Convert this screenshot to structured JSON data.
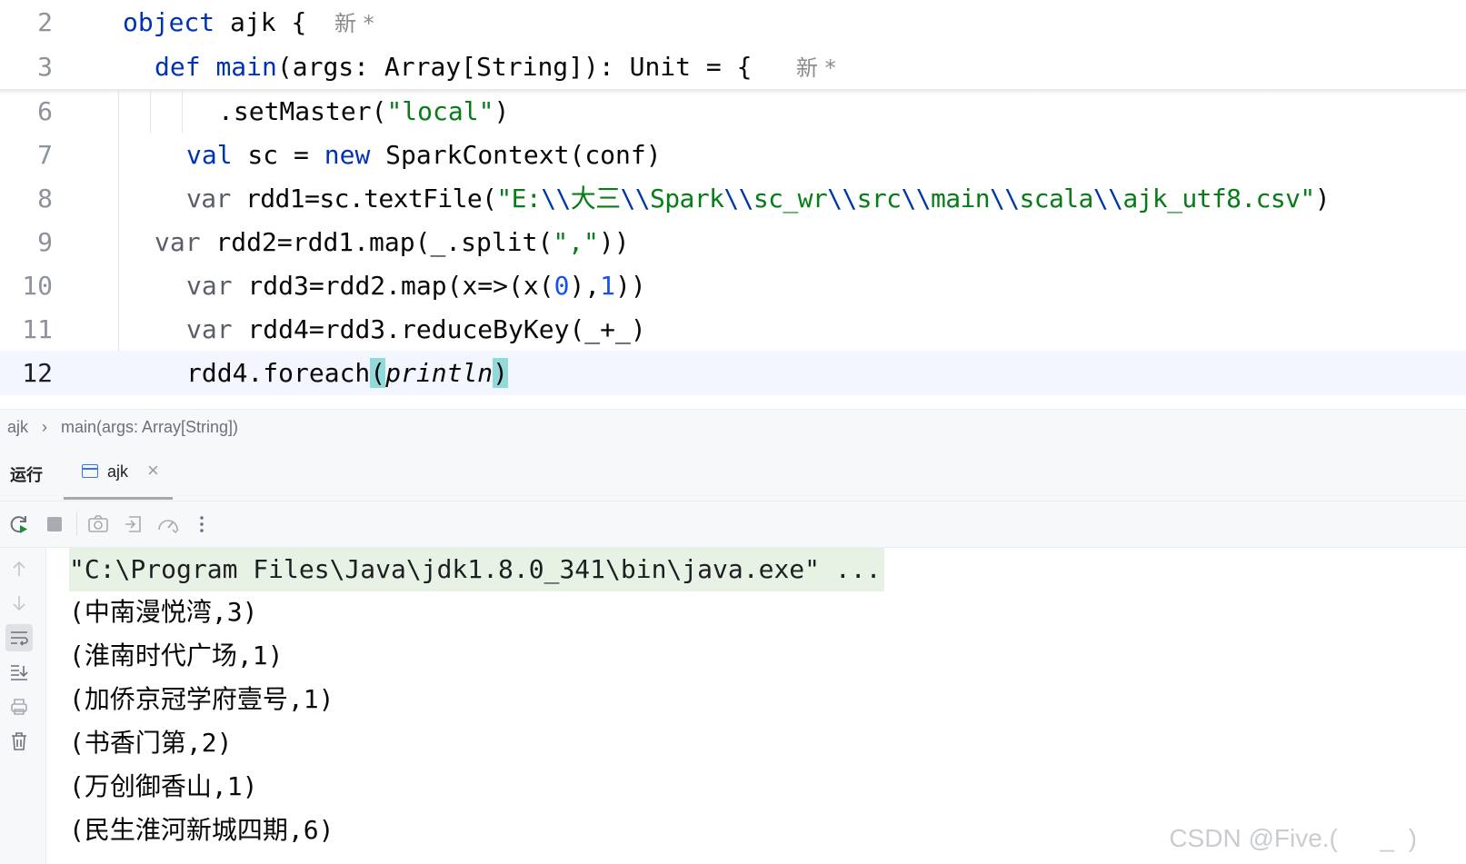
{
  "editor": {
    "lines": [
      {
        "num": "2",
        "segments": [
          {
            "t": "object",
            "c": "kw"
          },
          {
            "t": " ajk {",
            "c": ""
          }
        ],
        "hint": "新 *"
      },
      {
        "num": "3",
        "segments": [
          {
            "t": "def",
            "c": "kw"
          },
          {
            "t": " ",
            "c": ""
          },
          {
            "t": "main",
            "c": "kw"
          },
          {
            "t": "(args: Array[String]): Unit = {",
            "c": ""
          }
        ],
        "hint": "新 *"
      },
      {
        "num": "6",
        "segments": [
          {
            "t": ".setMaster(",
            "c": ""
          },
          {
            "t": "\"local\"",
            "c": "str"
          },
          {
            "t": ")",
            "c": ""
          }
        ]
      },
      {
        "num": "7",
        "segments": [
          {
            "t": "val",
            "c": "kw"
          },
          {
            "t": " sc = ",
            "c": ""
          },
          {
            "t": "new",
            "c": "kw"
          },
          {
            "t": " SparkContext(conf)",
            "c": ""
          }
        ]
      },
      {
        "num": "8",
        "segments": [
          {
            "t": "var",
            "c": "varkw"
          },
          {
            "t": " rdd1=sc.textFile(",
            "c": ""
          },
          {
            "t": "\"E:",
            "c": "str"
          },
          {
            "t": "\\\\",
            "c": "esc"
          },
          {
            "t": "大三",
            "c": "str"
          },
          {
            "t": "\\\\",
            "c": "esc"
          },
          {
            "t": "Spark",
            "c": "str"
          },
          {
            "t": "\\\\",
            "c": "esc"
          },
          {
            "t": "sc_wr",
            "c": "str"
          },
          {
            "t": "\\\\",
            "c": "esc"
          },
          {
            "t": "src",
            "c": "str"
          },
          {
            "t": "\\\\",
            "c": "esc"
          },
          {
            "t": "main",
            "c": "str"
          },
          {
            "t": "\\\\",
            "c": "esc"
          },
          {
            "t": "scala",
            "c": "str"
          },
          {
            "t": "\\\\",
            "c": "esc"
          },
          {
            "t": "ajk_utf8.csv\"",
            "c": "str"
          },
          {
            "t": ")",
            "c": ""
          }
        ]
      },
      {
        "num": "9",
        "segments": [
          {
            "t": "var",
            "c": "varkw"
          },
          {
            "t": " rdd2=rdd1.map(_.split(",
            "c": ""
          },
          {
            "t": "\",\"",
            "c": "str"
          },
          {
            "t": "))",
            "c": ""
          }
        ]
      },
      {
        "num": "10",
        "segments": [
          {
            "t": "var",
            "c": "varkw"
          },
          {
            "t": " rdd3=rdd2.map(x=>(x(",
            "c": ""
          },
          {
            "t": "0",
            "c": "num"
          },
          {
            "t": "),",
            "c": ""
          },
          {
            "t": "1",
            "c": "num"
          },
          {
            "t": "))",
            "c": ""
          }
        ]
      },
      {
        "num": "11",
        "segments": [
          {
            "t": "var",
            "c": "varkw"
          },
          {
            "t": " rdd4=rdd3.reduceByKey(_+_)",
            "c": ""
          }
        ]
      },
      {
        "num": "12",
        "segments": [
          {
            "t": "rdd4.foreach",
            "c": ""
          },
          {
            "t": "(",
            "c": "brace-hl"
          },
          {
            "t": "println",
            "c": "ital"
          },
          {
            "t": ")",
            "c": "brace-hl"
          }
        ]
      }
    ]
  },
  "breadcrumb": {
    "item1": "ajk",
    "separator": "›",
    "item2": "main(args: Array[String])"
  },
  "run": {
    "title": "运行",
    "tab_label": "ajk",
    "tab_close": "×",
    "toolbar_icons": [
      "rerun-icon",
      "stop-icon",
      "screenshot-icon",
      "restore-layout-icon",
      "profiler-icon",
      "more-icon"
    ],
    "gutter_icons": [
      "arrow-up-icon",
      "arrow-down-icon",
      "soft-wrap-icon",
      "scroll-to-end-icon",
      "print-icon",
      "trash-icon"
    ]
  },
  "console": {
    "command": "\"C:\\Program Files\\Java\\jdk1.8.0_341\\bin\\java.exe\" ...",
    "output": [
      "(中南漫悦湾,3)",
      "(淮南时代广场,1)",
      "(加侨京冠学府壹号,1)",
      "(书香门第,2)",
      "(万创御香山,1)",
      "(民生淮河新城四期,6)"
    ]
  },
  "watermark": "CSDN @Five.(      _  )",
  "colors": {
    "keyword": "#0033b3",
    "string": "#067d17",
    "number": "#1750eb",
    "brace_highlight": "#93d9d9",
    "current_line": "#f2f6fe"
  }
}
